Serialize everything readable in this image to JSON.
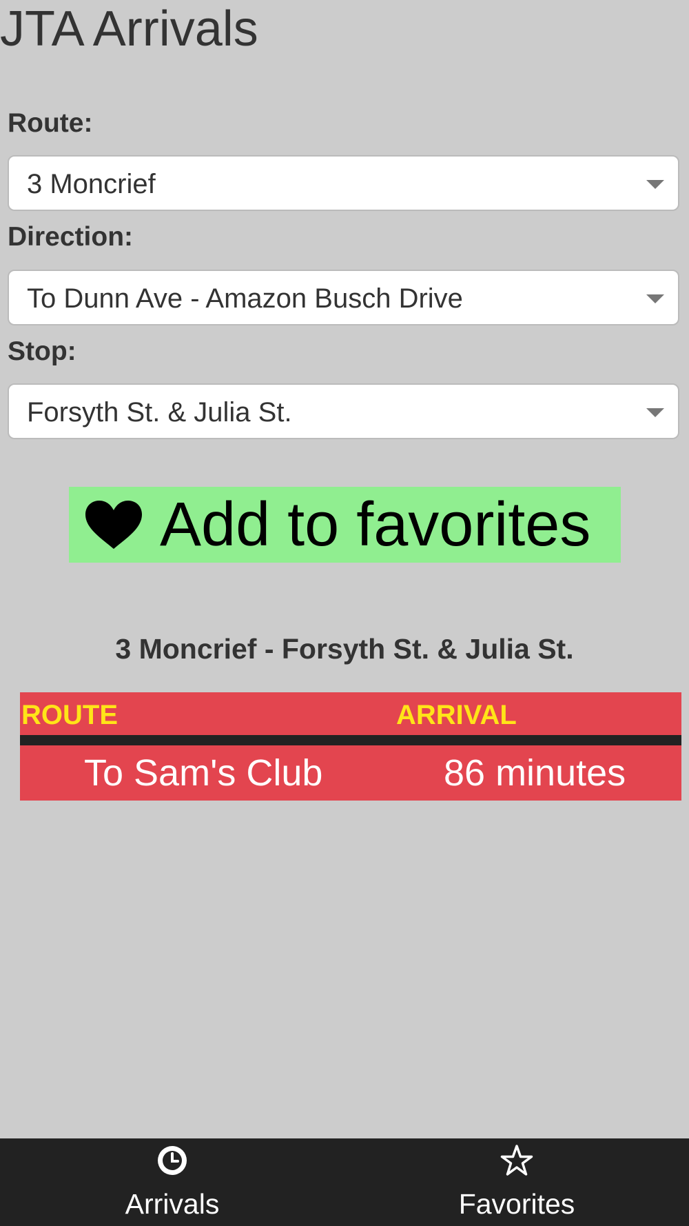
{
  "app": {
    "title": "JTA Arrivals"
  },
  "form": {
    "route_label": "Route:",
    "route_value": "3 Moncrief",
    "direction_label": "Direction:",
    "direction_value": "To Dunn Ave - Amazon Busch Drive",
    "stop_label": "Stop:",
    "stop_value": "Forsyth St. & Julia St."
  },
  "favorite_button": {
    "label": "Add to favorites",
    "icon": "heart-icon",
    "color": "#90ee90"
  },
  "results": {
    "heading": "3 Moncrief - Forsyth St. & Julia St.",
    "columns": [
      "ROUTE",
      "ARRIVAL"
    ],
    "rows": [
      {
        "route": "To Sam's Club",
        "arrival": "86 minutes"
      }
    ],
    "table_color": "#e3454f",
    "header_text_color": "#ffe418"
  },
  "tab_bar": {
    "tabs": [
      {
        "label": "Arrivals",
        "icon": "clock-icon"
      },
      {
        "label": "Favorites",
        "icon": "star-icon"
      }
    ]
  }
}
